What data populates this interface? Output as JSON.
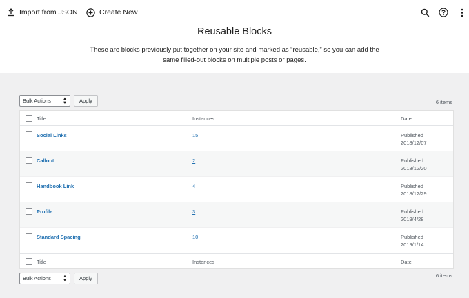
{
  "toolbar": {
    "import_label": "Import from JSON",
    "create_label": "Create New"
  },
  "header": {
    "title": "Reusable Blocks",
    "description": "These are blocks previously put together on your site and marked as “reusable,” so you can add the same filled-out blocks on multiple posts or pages."
  },
  "bulk": {
    "select_label": "Bulk Actions",
    "apply_label": "Apply",
    "item_count": "6 items"
  },
  "table": {
    "columns": {
      "title": "Title",
      "instances": "Instances",
      "date": "Date"
    },
    "rows": [
      {
        "title": "Social Links",
        "instances": "15",
        "status": "Published",
        "date": "2018/12/07"
      },
      {
        "title": "Callout",
        "instances": "2",
        "status": "Published",
        "date": "2018/12/20"
      },
      {
        "title": "Handbook Link",
        "instances": "4",
        "status": "Published",
        "date": "2018/12/29"
      },
      {
        "title": "Profile",
        "instances": "3",
        "status": "Published",
        "date": "2019/4/28"
      },
      {
        "title": "Standard Spacing",
        "instances": "10",
        "status": "Published",
        "date": "2019/1/14"
      }
    ]
  }
}
